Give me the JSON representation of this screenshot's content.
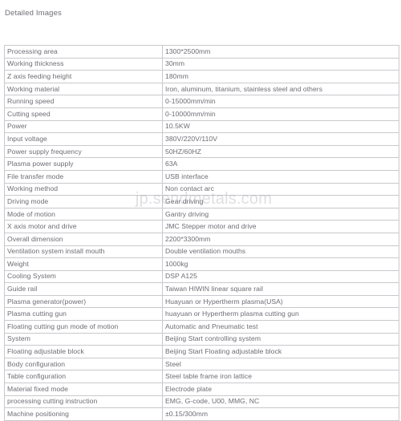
{
  "page": {
    "title": "Detailed Images"
  },
  "watermark": {
    "text": "jp.sendmetals.com"
  },
  "colors": {
    "text": "#6d6d75",
    "border": "#c9c9cd",
    "background": "#ffffff",
    "watermark": "rgba(150,150,158,0.30)"
  },
  "spec_table": {
    "rows": [
      {
        "label": "Processing area",
        "value": "1300*2500mm"
      },
      {
        "label": "Working thickness",
        "value": "30mm"
      },
      {
        "label": "Z axis feeding height",
        "value": "180mm"
      },
      {
        "label": "Working material",
        "value": "Iron, aluminum, titanium, stainless steel and others"
      },
      {
        "label": "Running speed",
        "value": "0-15000mm/min"
      },
      {
        "label": "Cutting speed",
        "value": "0-10000mm/min"
      },
      {
        "label": "Power",
        "value": "10.5KW"
      },
      {
        "label": "Input voltage",
        "value": "380V/220V/110V"
      },
      {
        "label": "Power supply frequency",
        "value": "50HZ/60HZ"
      },
      {
        "label": "Plasma power supply",
        "value": "63A"
      },
      {
        "label": "File transfer mode",
        "value": "USB interface"
      },
      {
        "label": "Working method",
        "value": "Non contact arc"
      },
      {
        "label": "Driving mode",
        "value": "Gear driving"
      },
      {
        "label": "Mode of motion",
        "value": "Gantry driving"
      },
      {
        "label": "X axis motor and drive",
        "value": "JMC Stepper motor and drive"
      },
      {
        "label": "Overall dimension",
        "value": "2200*3300mm"
      },
      {
        "label": "Ventilation system install mouth",
        "value": "Double ventilation mouths"
      },
      {
        "label": "Weight",
        "value": "1000kg"
      },
      {
        "label": "Cooling System",
        "value": " DSP A125"
      },
      {
        "label": "Guide rail",
        "value": "Taiwan HIWIN linear square rail"
      },
      {
        "label": "Plasma generator(power)",
        "value": "Huayuan or Hypertherm plasma(USA)"
      },
      {
        "label": "Plasma cutting gun",
        "value": "huayuan or Hypertherm plasma cutting gun"
      },
      {
        "label": "Floating cutting gun mode of motion",
        "value": "Automatic and Pneumatic test"
      },
      {
        "label": "System",
        "value": "Beijing Start controlling system"
      },
      {
        "label": "Floating adjustable block",
        "value": "Beijing Start Floating adjustable block"
      },
      {
        "label": "Body configuration",
        "value": "Steel"
      },
      {
        "label": "Table configuration",
        "value": "Steel table frame iron lattice"
      },
      {
        "label": "Material fixed mode",
        "value": "Electrode plate"
      },
      {
        "label": "processing cutting instruction",
        "value": "EMG, G-code, U00, MMG, NC"
      },
      {
        "label": "Machine positioning",
        "value": "±0.15/300mm"
      }
    ]
  }
}
